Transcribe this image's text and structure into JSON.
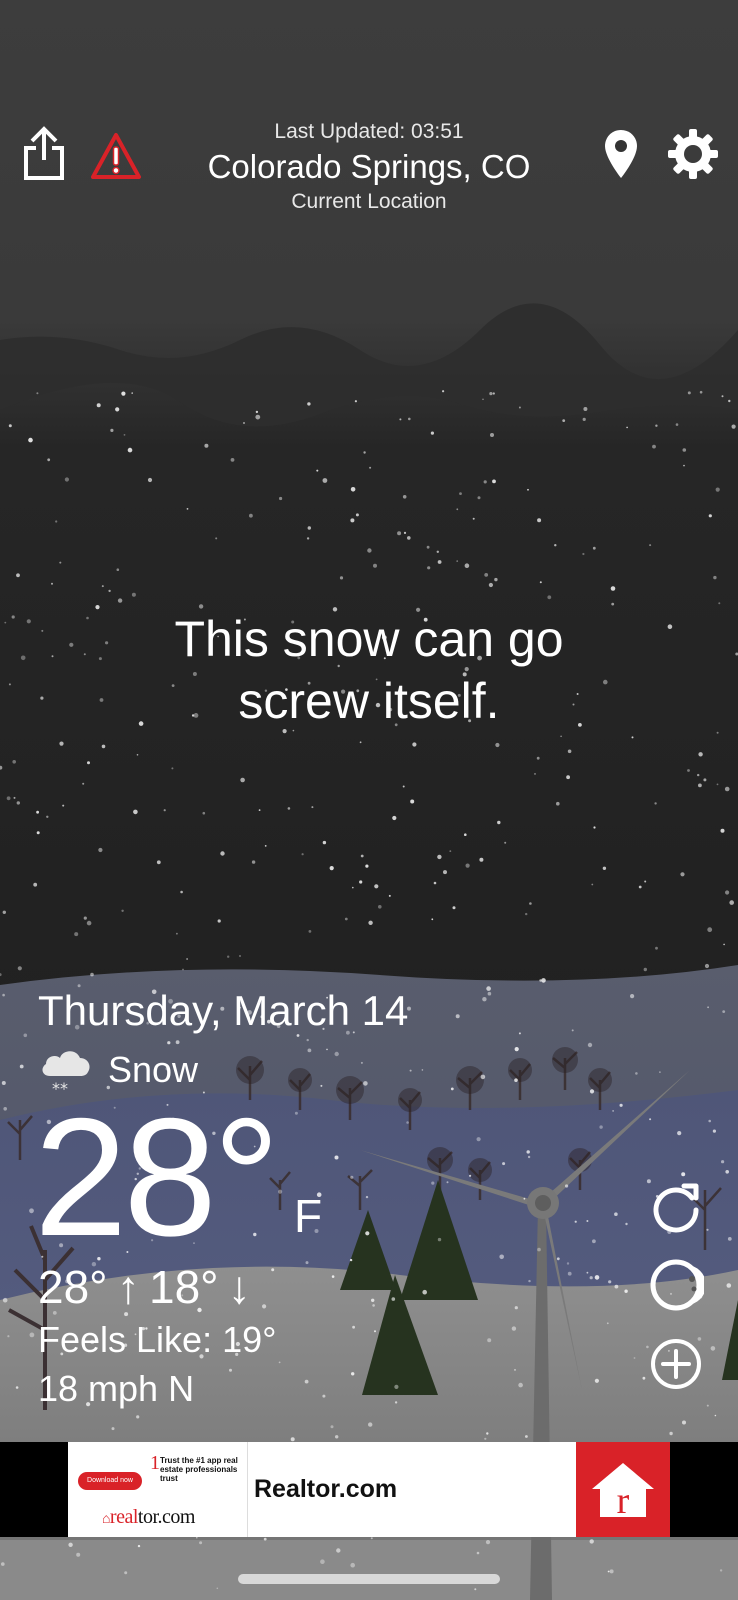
{
  "header": {
    "last_updated": "Last Updated: 03:51",
    "city": "Colorado Springs, CO",
    "current_location": "Current Location"
  },
  "quip": {
    "line1": "This snow can go",
    "line2": "screw itself."
  },
  "weather": {
    "date": "Thursday, March 14",
    "condition": "Snow",
    "condition_icon": "cloud-snow-icon",
    "temperature": "28°",
    "unit": "F",
    "hi_lo": "28° ↑ 18° ↓",
    "feels_like": "Feels Like: 19°",
    "wind": "18 mph N"
  },
  "icons": {
    "share": "share-icon",
    "alert": "warning-triangle-icon",
    "location": "location-pin-icon",
    "settings": "gear-icon",
    "refresh": "refresh-icon",
    "radar": "radar-moon-icon",
    "add": "add-circle-icon"
  },
  "ad": {
    "cta": "Download now",
    "tagline": "Trust the #1 app real estate professionals trust",
    "brand_small_red": "real",
    "brand_small_black": "tor.com",
    "title": "Realtor.com",
    "logo_letter": "r"
  },
  "colors": {
    "alert_red": "#d92228",
    "sky_top": "#3a3a3a",
    "sky": "#1f1f1f",
    "hill_blue": "#4b5270",
    "ground": "#8a8a8a",
    "tree_green": "#27331f",
    "ad_red": "#d92228"
  }
}
